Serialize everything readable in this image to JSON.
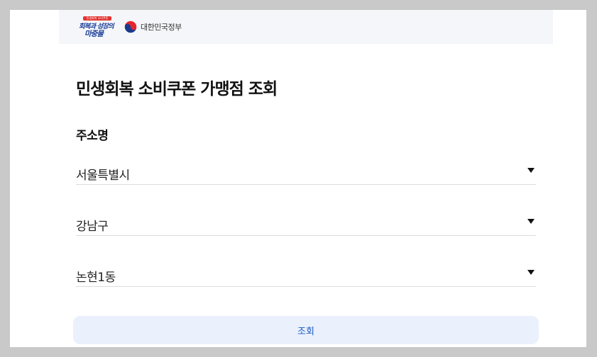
{
  "header": {
    "campaign_logo_ribbon": "민생회복 소비쿠폰",
    "campaign_logo_line1": "회복과 성장의",
    "campaign_logo_line2": "마중물",
    "gov_name": "대한민국정부"
  },
  "page": {
    "title": "민생회복 소비쿠폰 가맹점 조회"
  },
  "address": {
    "label": "주소명",
    "sido": "서울특별시",
    "sigungu": "강남구",
    "dong": "논현1동"
  },
  "actions": {
    "search_label": "조회"
  },
  "colors": {
    "button_bg": "#eaf1fd",
    "button_text": "#1a56c8",
    "header_bg": "#f4f6f9"
  },
  "icons": {
    "dropdown": "caret-down-icon",
    "emblem": "taegeuk-emblem-icon"
  }
}
